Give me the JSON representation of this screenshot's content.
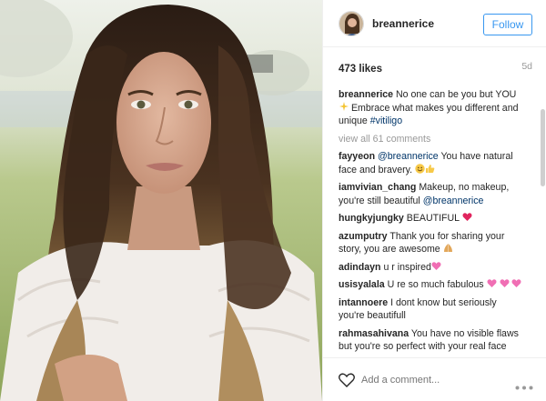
{
  "post": {
    "username": "breannerice",
    "follow_label": "Follow",
    "likes": "473 likes",
    "posted_ago": "5d"
  },
  "caption": {
    "username": "breannerice",
    "text_1": "No one can be you but YOU",
    "emoji_1": "sparkles-emoji",
    "text_2": " Embrace what makes you different and unique ",
    "hashtag": "#vitiligo"
  },
  "view_all": "view all 61 comments",
  "comments": [
    {
      "username": "fayyeon",
      "mention": "@breannerice",
      "text": " You have natural face and bravery. ",
      "emojis": [
        "smile-emoji",
        "thumbs-up-emoji"
      ]
    },
    {
      "username": "iamvivian_chang",
      "text": "Makeup, no makeup, you're still beautiful ",
      "mention": "@breannerice"
    },
    {
      "username": "hungkyjungky",
      "text": "BEAUTIFUL ",
      "emojis": [
        "red-heart-emoji"
      ]
    },
    {
      "username": "azumputry",
      "text": "Thank you for sharing your story, you are awesome ",
      "emojis": [
        "praying-hands-emoji"
      ]
    },
    {
      "username": "adindayn",
      "text": "u r inspired",
      "emojis": [
        "sparkling-heart-emoji"
      ]
    },
    {
      "username": "usisyalala",
      "text": "U re so much fabulous ",
      "emojis": [
        "sparkling-heart-emoji",
        "sparkling-heart-emoji",
        "sparkling-heart-emoji"
      ]
    },
    {
      "username": "intannoere",
      "text": "I dont know but seriously you're beautifull"
    },
    {
      "username": "rahmasahivana",
      "text": "You have no visible flaws but you're so perfect with your real face"
    }
  ],
  "footer": {
    "add_comment_placeholder": "Add a comment...",
    "like_icon": "heart-outline-icon",
    "more_icon": "more-options-icon"
  },
  "colors": {
    "link": "#003569",
    "follow_blue": "#3897f0",
    "muted": "#999999"
  }
}
